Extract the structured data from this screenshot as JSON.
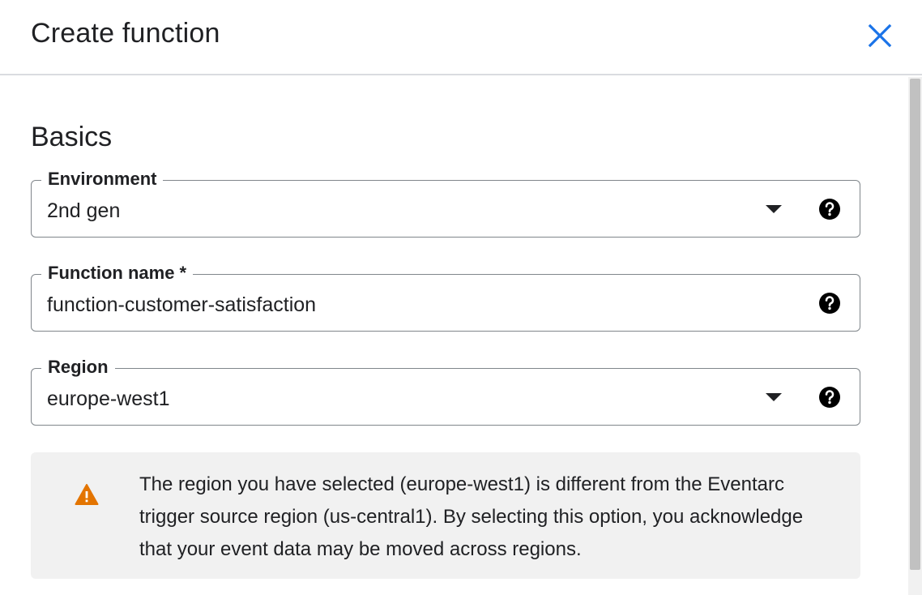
{
  "dialog": {
    "title": "Create function",
    "close_icon": "close-icon"
  },
  "section": {
    "title": "Basics"
  },
  "fields": {
    "environment": {
      "label": "Environment",
      "value": "2nd gen",
      "type": "select"
    },
    "function_name": {
      "label": "Function name *",
      "value": "function-customer-satisfaction",
      "type": "text"
    },
    "region": {
      "label": "Region",
      "value": "europe-west1",
      "type": "select"
    }
  },
  "warning": {
    "icon": "warning-icon",
    "text": "The region you have selected (europe-west1) is different from the Eventarc trigger source region (us-central1). By selecting this option, you acknowledge that your event data may be moved across regions."
  },
  "colors": {
    "accent": "#1a73e8",
    "warning": "#e37400",
    "border": "#80868b",
    "warning_bg": "#f1f1f1"
  }
}
